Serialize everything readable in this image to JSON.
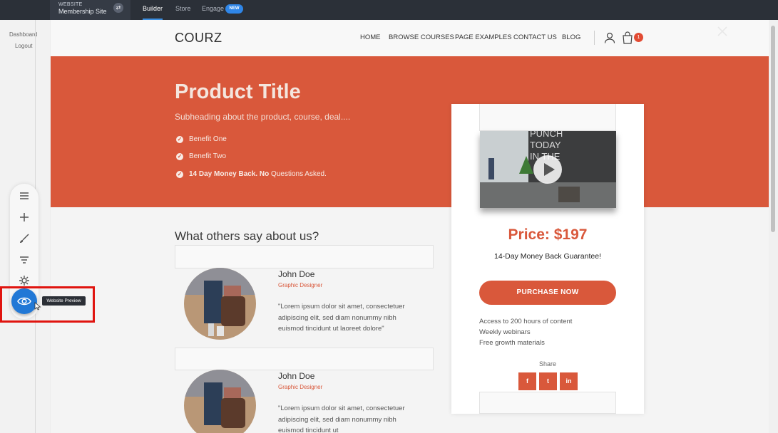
{
  "topbar": {
    "site_kicker": "WEBSITE",
    "site_name": "Membership Site",
    "tabs": [
      "Builder",
      "Store",
      "Engage"
    ],
    "new_badge": "NEW"
  },
  "leftrail": {
    "links": [
      "Dashboard",
      "Logout"
    ]
  },
  "site": {
    "logo": "COURZ",
    "nav": [
      "HOME",
      "BROWSE COURSES",
      "PAGE EXAMPLES",
      "CONTACT US",
      "BLOG"
    ],
    "cart_count": "1"
  },
  "hero": {
    "title": "Product Title",
    "subheading": "Subheading about the product, course, deal....",
    "benefits": [
      "Benefit One",
      "Benefit Two"
    ],
    "benefit3_bold": "14 Day Money Back. No",
    "benefit3_rest": " Questions Asked."
  },
  "testimonials": {
    "title": "What others say about us?",
    "items": [
      {
        "name": "John Doe",
        "role": "Graphic Designer",
        "quote": "\"Lorem ipsum dolor sit amet, consectetuer adipiscing elit, sed diam nonummy nibh euismod tincidunt ut laoreet dolore\""
      },
      {
        "name": "John Doe",
        "role": "Graphic Designer",
        "quote": "\"Lorem ipsum dolor sit amet, consectetuer adipiscing elit, sed diam nonummy nibh euismod tincidunt ut"
      }
    ]
  },
  "card": {
    "video_overlay_text": "PUNCH TODAY IN THE",
    "price": "Price: $197",
    "guarantee": "14-Day Money Back Guarantee!",
    "cta": "PURCHASE NOW",
    "features": [
      "Access to 200 hours of content",
      "Weekly webinars",
      "Free growth materials"
    ],
    "share_label": "Share",
    "social": [
      "f",
      "t",
      "in"
    ]
  },
  "toolbar": {
    "tooltip": "Website Preview",
    "tools": [
      "menu-icon",
      "plus-icon",
      "brush-icon",
      "filter-icon",
      "gear-icon",
      "eye-icon"
    ]
  },
  "colors": {
    "brand": "#d9583b",
    "topbar": "#2b3038",
    "accent": "#2178d6",
    "highlight": "#e0140f"
  }
}
